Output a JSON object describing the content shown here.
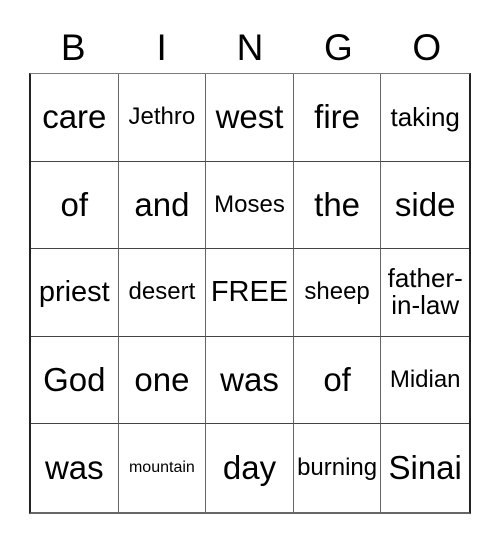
{
  "header": {
    "letters": [
      "B",
      "I",
      "N",
      "G",
      "O"
    ]
  },
  "cells": [
    [
      "care",
      "Jethro",
      "west",
      "fire",
      "taking"
    ],
    [
      "of",
      "and",
      "Moses",
      "the",
      "side"
    ],
    [
      "priest",
      "desert",
      "FREE",
      "sheep",
      "father-in-law"
    ],
    [
      "God",
      "one",
      "was",
      "of",
      "Midian"
    ],
    [
      "was",
      "mountain",
      "day",
      "burning",
      "Sinai"
    ]
  ]
}
